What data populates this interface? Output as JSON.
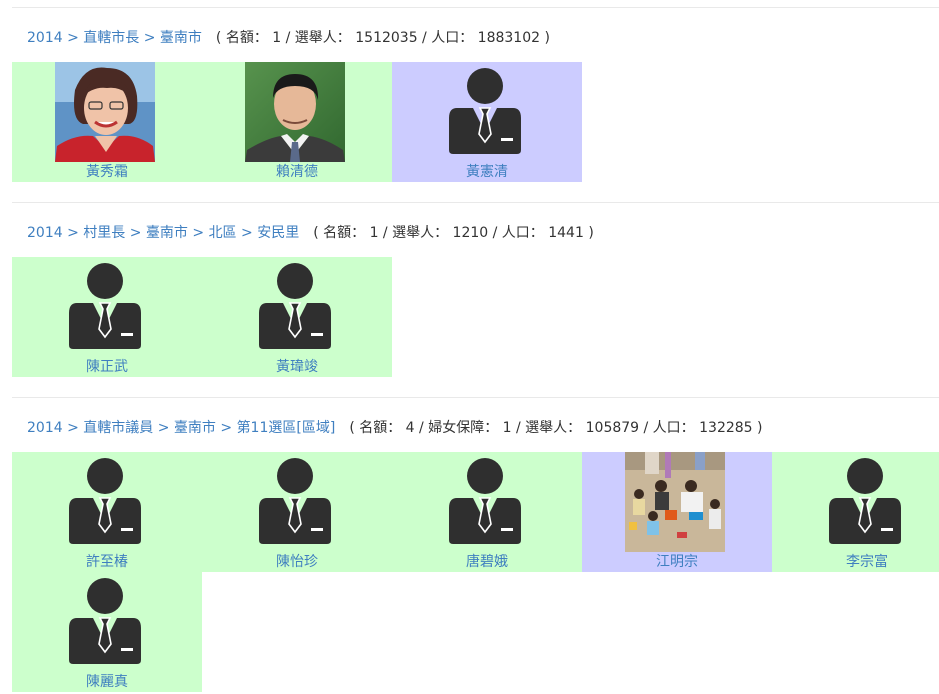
{
  "sections": [
    {
      "crumbs": [
        "2014",
        "直轄市長",
        "臺南市"
      ],
      "meta": "( 名額： 1 / 選舉人： 1512035 / 人口： 1883102 )",
      "candidates": [
        {
          "name": "黃秀霜",
          "photo": "photo-woman",
          "bg": "#ccffcc"
        },
        {
          "name": "賴清德",
          "photo": "photo-man",
          "bg": "#ccffcc"
        },
        {
          "name": "黃憲清",
          "photo": "person-silhouette-icon",
          "bg": "#ccccff"
        }
      ]
    },
    {
      "crumbs": [
        "2014",
        "村里長",
        "臺南市",
        "北區",
        "安民里"
      ],
      "meta": "( 名額： 1 / 選舉人： 1210 / 人口： 1441 )",
      "candidates": [
        {
          "name": "陳正武",
          "photo": "person-silhouette-icon",
          "bg": "#ccffcc"
        },
        {
          "name": "黃瑋竣",
          "photo": "person-silhouette-icon",
          "bg": "#ccffcc"
        }
      ]
    },
    {
      "crumbs": [
        "2014",
        "直轄市議員",
        "臺南市",
        "第11選區[區域]"
      ],
      "meta": "( 名額： 4 / 婦女保障： 1 / 選舉人： 105879 / 人口： 132285 )",
      "candidates": [
        {
          "name": "許至椿",
          "photo": "person-silhouette-icon",
          "bg": "#ccffcc"
        },
        {
          "name": "陳怡珍",
          "photo": "person-silhouette-icon",
          "bg": "#ccffcc"
        },
        {
          "name": "唐碧娥",
          "photo": "person-silhouette-icon",
          "bg": "#ccffcc"
        },
        {
          "name": "江明宗",
          "photo": "photo-children-sandbox",
          "bg": "#ccccff"
        },
        {
          "name": "李宗富",
          "photo": "person-silhouette-icon",
          "bg": "#ccffcc"
        },
        {
          "name": "陳麗真",
          "photo": "person-silhouette-icon",
          "bg": "#ccffcc"
        }
      ]
    }
  ]
}
